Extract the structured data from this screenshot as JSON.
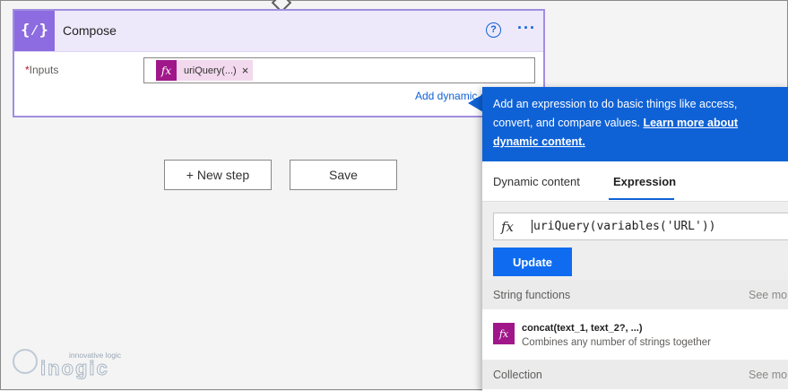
{
  "compose": {
    "title": "Compose",
    "help_icon_glyph": "?",
    "more_icon_glyph": "···",
    "inputs_required_mark": "*",
    "inputs_label": "Inputs",
    "token_icon": "fx",
    "token_label": "uriQuery(...)",
    "token_close": "×",
    "add_dynamic_label": "Add dynamic content"
  },
  "buttons": {
    "new_step": "+ New step",
    "save": "Save"
  },
  "panel": {
    "info_text": "Add an expression to do basic things like access, convert, and compare values.",
    "learn_more": "Learn more about dynamic content.",
    "tabs": [
      {
        "label": "Dynamic content",
        "active": false
      },
      {
        "label": "Expression",
        "active": true
      }
    ],
    "expression_value": "uriQuery(variables('URL'))",
    "fx_icon": "fx",
    "update_label": "Update",
    "sections": [
      {
        "title": "String functions",
        "see_more": "See more",
        "items": [
          {
            "name": "concat(text_1, text_2?, ...)",
            "description": "Combines any number of strings together"
          }
        ]
      },
      {
        "title": "Collection",
        "see_more": "See more",
        "items": []
      }
    ]
  },
  "logo": {
    "tagline": "innovative logic",
    "word": "inogic"
  },
  "colors": {
    "accent": "#0f62d6",
    "compose_icon_bg": "#8c6ce0",
    "expression_token": "#a0178a"
  }
}
